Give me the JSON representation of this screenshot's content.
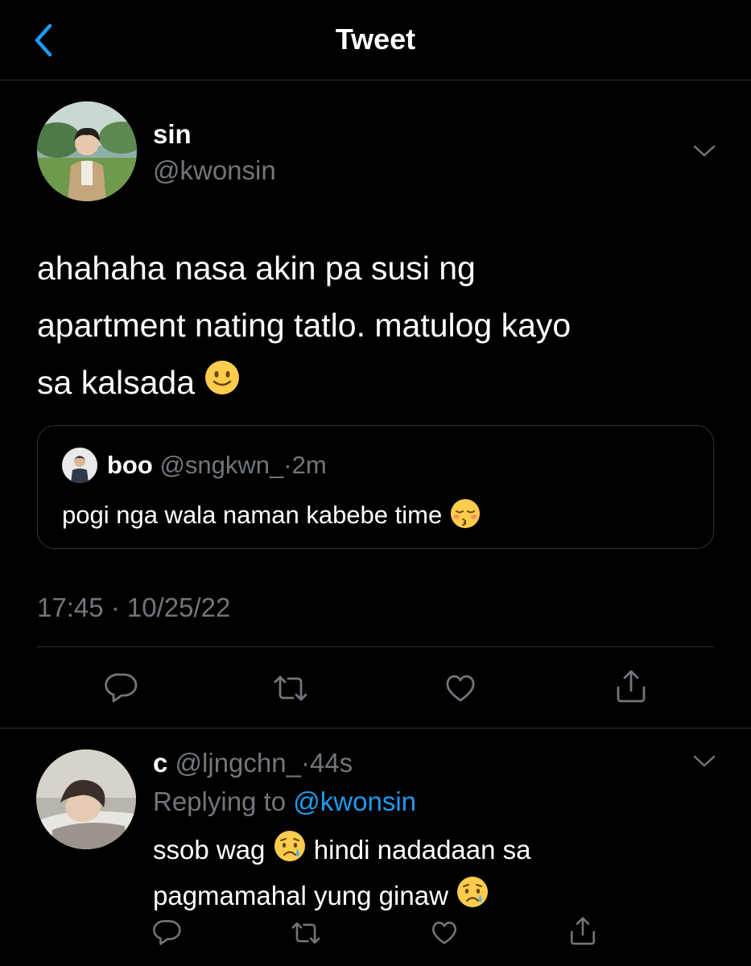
{
  "header": {
    "title": "Tweet"
  },
  "tweet": {
    "author_name": "sin",
    "author_handle": "@kwonsin",
    "text_line1": "ahahaha nasa akin pa susi ng",
    "text_line2": "apartment nating tatlo. matulog kayo",
    "text_line3": "sa kalsada",
    "text_emoji": "slightly-smiling-face",
    "timestamp": "17:45 · 10/25/22"
  },
  "quote": {
    "author_name": "boo",
    "author_handle": "@sngkwn_",
    "separator": "·",
    "time": "2m",
    "text": "pogi nga wala naman kabebe time",
    "text_emoji": "kissing-face-closed-eyes"
  },
  "actions": {
    "icons": [
      "reply-icon",
      "retweet-icon",
      "like-icon",
      "share-icon"
    ]
  },
  "reply": {
    "author_name": "c",
    "author_handle": "@ljngchn_",
    "separator": "·",
    "time": "44s",
    "replying_label": "Replying to",
    "replying_to": "@kwonsin",
    "text_part1": "ssob wag",
    "text_part2": "hindi nadadaan sa",
    "text_part3": "pagmamahal yung ginaw",
    "text_emoji": "crying-face"
  },
  "colors": {
    "background": "#000000",
    "accent": "#1d9bf0",
    "muted": "#71767b",
    "divider": "#2f3336"
  }
}
